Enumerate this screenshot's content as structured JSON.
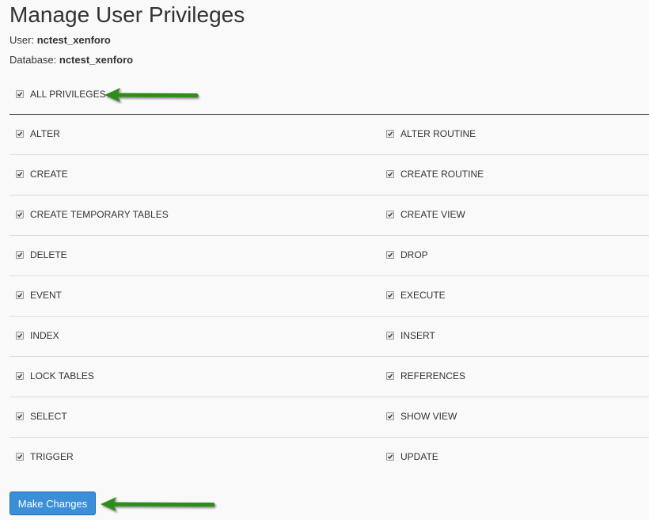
{
  "page": {
    "title": "Manage User Privileges",
    "user_label": "User:",
    "user_value": "nctest_xenforo",
    "db_label": "Database:",
    "db_value": "nctest_xenforo"
  },
  "all_privileges": {
    "label": "ALL PRIVILEGES",
    "checked": true
  },
  "privileges": [
    [
      "ALTER",
      "ALTER ROUTINE"
    ],
    [
      "CREATE",
      "CREATE ROUTINE"
    ],
    [
      "CREATE TEMPORARY TABLES",
      "CREATE VIEW"
    ],
    [
      "DELETE",
      "DROP"
    ],
    [
      "EVENT",
      "EXECUTE"
    ],
    [
      "INDEX",
      "INSERT"
    ],
    [
      "LOCK TABLES",
      "REFERENCES"
    ],
    [
      "SELECT",
      "SHOW VIEW"
    ],
    [
      "TRIGGER",
      "UPDATE"
    ]
  ],
  "actions": {
    "submit_label": "Make Changes"
  },
  "colors": {
    "button": "#3b8fd9",
    "arrow": "#2e8b1e",
    "text": "#333333",
    "background": "#f9f9f9"
  }
}
